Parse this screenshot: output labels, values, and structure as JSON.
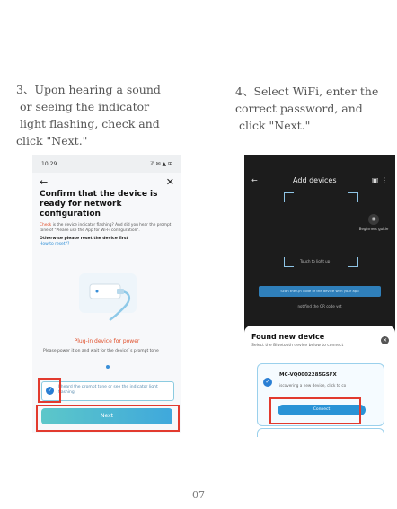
{
  "step3": {
    "text": "3、Upon hearing a sound\n or seeing the indicator\n light flashing, check and\nclick \"Next.\""
  },
  "step4": {
    "text": "4、Select WiFi, enter the\ncorrect password, and\n click \"Next.\""
  },
  "phone1": {
    "status_time": "10:29",
    "status_icons": "ℤ ✉ ▲ ⊞",
    "back_icon": "←",
    "close_icon": "✕",
    "title": "Confirm that the device is ready for network configuration",
    "desc_red": "Check",
    "desc": " is the device indicator flashing? And did you hear the prompt tone of \"Please use the App for Wi-Fi configuration\".",
    "reset_text": "Otherwise please reset the device first",
    "reset_link": "How to reset??",
    "plug_label": "Plug-in device for power",
    "plug_desc": "Please power it on and wait for the device`s prompt tone",
    "checkbox_label": "I heard the prompt tone or see the indicator light flashing",
    "next_label": "Next"
  },
  "phone2": {
    "title": "Add devices",
    "beginner_label": "Beginners guide",
    "scan_hint": "Touch to light up",
    "scan_bar": "Scan the QR code of the device with your app",
    "find_qr": "not find the QR code yet",
    "sheet_title": "Found new device",
    "sheet_sub": "Select the Bluetooth device below to connect",
    "device_name": "MC-VQ0002285GSFX",
    "device_status": "iscovering a new device, click to co",
    "connect_label": "Connect"
  },
  "page_number": "07",
  "colors": {
    "highlight": "#e23a2e",
    "accent": "#2a93d6"
  }
}
